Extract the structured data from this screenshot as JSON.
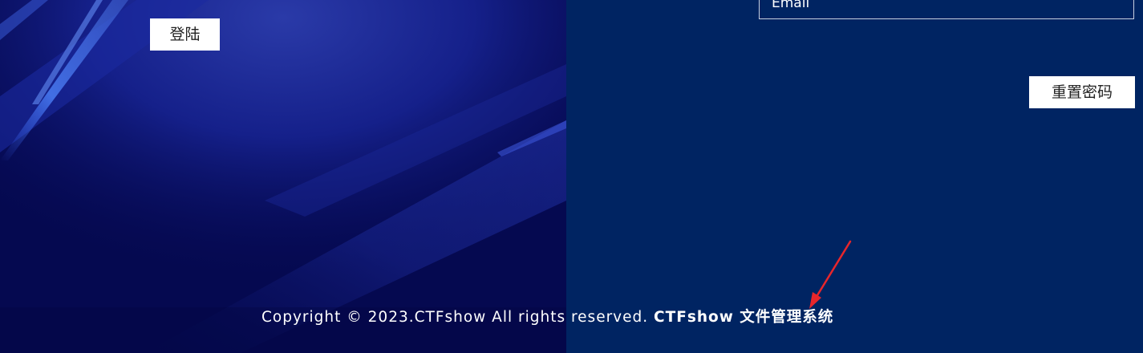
{
  "left_panel": {
    "login_button_label": "登陆"
  },
  "right_panel": {
    "email_placeholder": "Email",
    "reset_button_label": "重置密码"
  },
  "footer": {
    "copyright": "Copyright © 2023.CTFshow All rights reserved.",
    "brand": "CTFshow 文件管理系统"
  },
  "colors": {
    "left_background": "#060a55",
    "right_background": "#002462",
    "button_background": "#ffffff",
    "annotation_arrow": "#e8262b"
  }
}
